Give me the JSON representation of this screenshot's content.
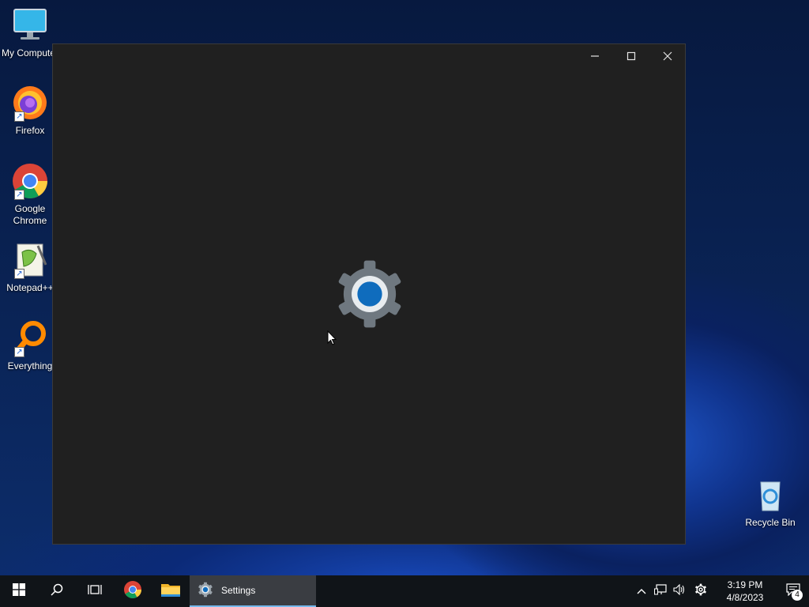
{
  "desktop": {
    "icons": [
      {
        "label": "My Computer"
      },
      {
        "label": "Firefox"
      },
      {
        "label": "Google Chrome"
      },
      {
        "label": "Notepad++"
      },
      {
        "label": "Everything"
      },
      {
        "label": "Recycle Bin"
      }
    ]
  },
  "window": {
    "app_name": "Settings",
    "splash_icon": "gear-icon",
    "controls": {
      "minimize": "minimize-icon",
      "maximize": "maximize-icon",
      "close": "close-icon"
    }
  },
  "taskbar": {
    "active_app": "Settings",
    "clock": {
      "time": "3:19 PM",
      "date": "4/8/2023"
    },
    "notification_count": "4"
  },
  "colors": {
    "window_bg": "#202020",
    "taskbar_bg": "#101418",
    "accent": "#0f6cbd"
  }
}
